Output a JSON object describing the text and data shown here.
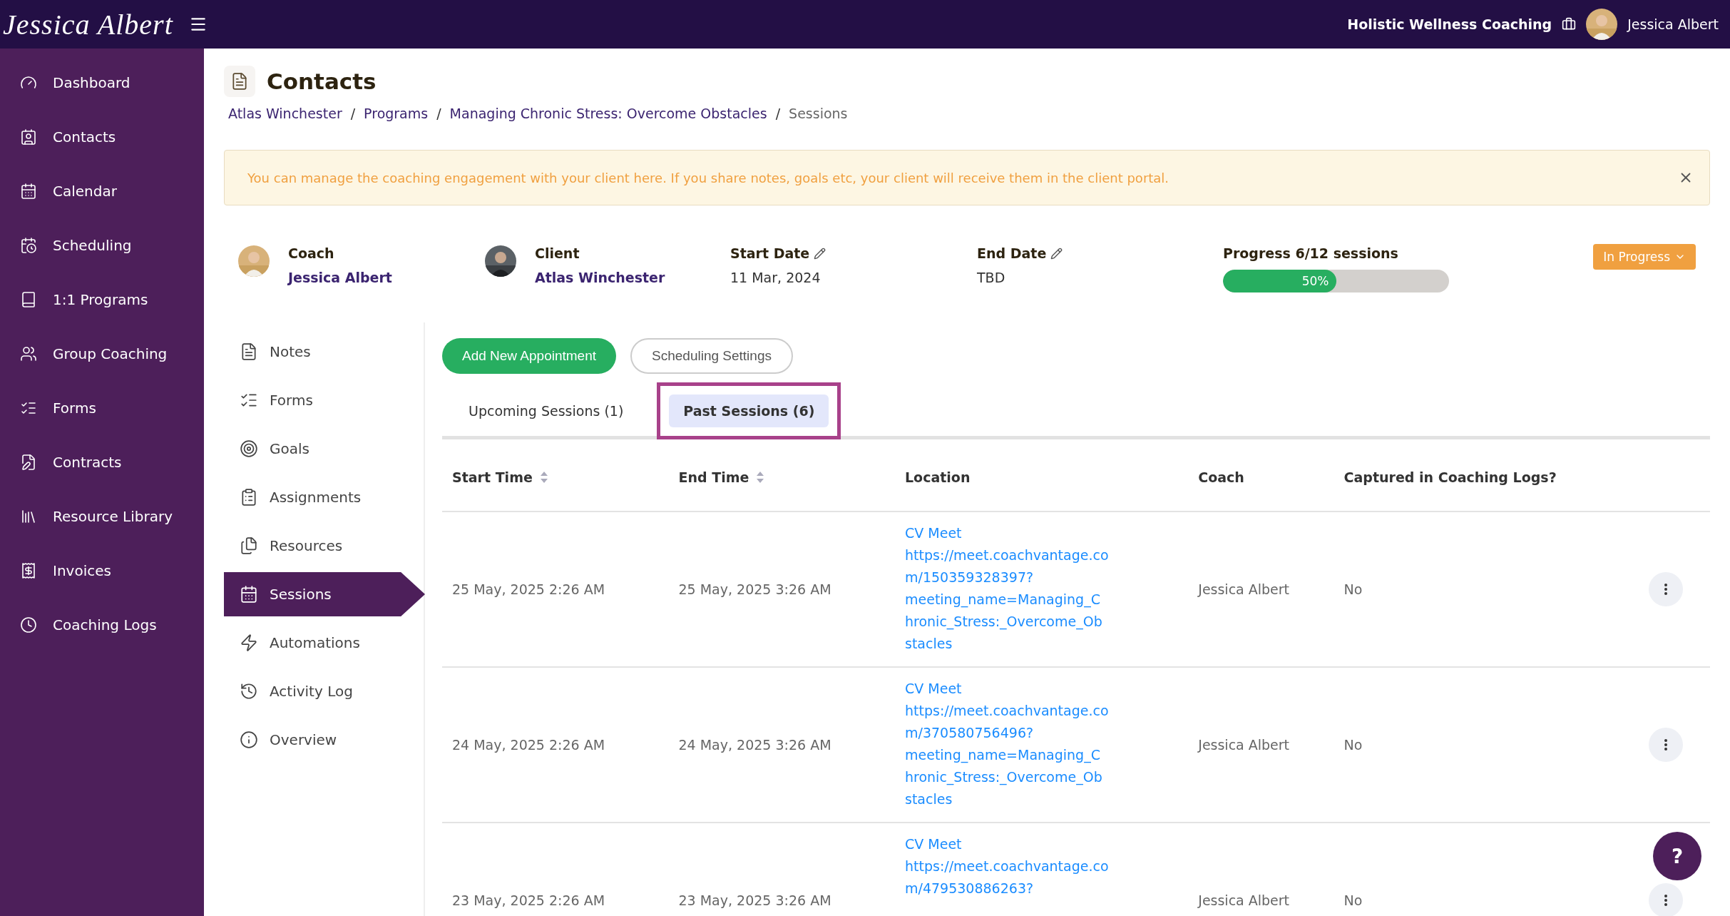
{
  "header": {
    "logo": "Jessica Albert",
    "business": "Holistic Wellness Coaching",
    "user": "Jessica Albert"
  },
  "sidebar": {
    "items": [
      {
        "label": "Dashboard",
        "selected": false
      },
      {
        "label": "Contacts",
        "selected": false
      },
      {
        "label": "Calendar",
        "selected": false
      },
      {
        "label": "Scheduling",
        "selected": false
      },
      {
        "label": "1:1 Programs",
        "selected": false
      },
      {
        "label": "Group Coaching",
        "selected": false
      },
      {
        "label": "Forms",
        "selected": false
      },
      {
        "label": "Contracts",
        "selected": false
      },
      {
        "label": "Resource Library",
        "selected": false
      },
      {
        "label": "Invoices",
        "selected": false
      },
      {
        "label": "Coaching Logs",
        "selected": false
      }
    ]
  },
  "page": {
    "title": "Contacts",
    "breadcrumb": {
      "separator": "/",
      "items": [
        {
          "label": "Atlas Winchester",
          "current": false
        },
        {
          "label": "Programs",
          "current": false
        },
        {
          "label": "Managing Chronic Stress: Overcome Obstacles",
          "current": false
        },
        {
          "label": "Sessions",
          "current": true
        }
      ]
    },
    "alert": {
      "text": "You can manage the coaching engagement with your client here. If you share notes, goals etc, your client will receive them in the client portal.",
      "dismissible": true
    },
    "coach": {
      "label": "Coach",
      "name": "Jessica Albert"
    },
    "client": {
      "label": "Client",
      "name": "Atlas Winchester"
    },
    "start_date": {
      "label": "Start Date",
      "value": "11 Mar, 2024",
      "editable": true
    },
    "end_date": {
      "label": "End Date",
      "value": "TBD",
      "editable": true
    },
    "progress": {
      "label": "Progress 6/12 sessions",
      "level": 0.5,
      "reading": "50%"
    },
    "status": {
      "label": "In Progress"
    }
  },
  "program_nav": {
    "items": [
      {
        "label": "Notes",
        "selected": false
      },
      {
        "label": "Forms",
        "selected": false
      },
      {
        "label": "Goals",
        "selected": false
      },
      {
        "label": "Assignments",
        "selected": false
      },
      {
        "label": "Resources",
        "selected": false
      },
      {
        "label": "Sessions",
        "selected": true
      },
      {
        "label": "Automations",
        "selected": false
      },
      {
        "label": "Activity Log",
        "selected": false
      },
      {
        "label": "Overview",
        "selected": false
      }
    ]
  },
  "actions": [
    {
      "label": "Add New Appointment",
      "kind": "primary"
    },
    {
      "label": "Scheduling Settings",
      "kind": "outline"
    }
  ],
  "tabs": [
    {
      "label": "Upcoming Sessions (1)",
      "selected": false,
      "highlighted": false
    },
    {
      "label": "Past Sessions (6)",
      "selected": true,
      "highlighted": true
    }
  ],
  "table": {
    "columns": [
      {
        "label": "Start Time",
        "sortable": true
      },
      {
        "label": "End Time",
        "sortable": true
      },
      {
        "label": "Location",
        "sortable": false
      },
      {
        "label": "Coach",
        "sortable": false
      },
      {
        "label": "Captured in Coaching Logs?",
        "sortable": false
      }
    ],
    "rows": [
      {
        "start": "25 May, 2025 2:26 AM",
        "end": "25 May, 2025 3:26 AM",
        "location_lines": [
          "CV Meet",
          "https://meet.coachvantage.co",
          "m/150359328397?",
          "meeting_name=Managing_C",
          "hronic_Stress:_Overcome_Ob",
          "stacles"
        ],
        "coach": "Jessica Albert",
        "captured": "No"
      },
      {
        "start": "24 May, 2025 2:26 AM",
        "end": "24 May, 2025 3:26 AM",
        "location_lines": [
          "CV Meet",
          "https://meet.coachvantage.co",
          "m/370580756496?",
          "meeting_name=Managing_C",
          "hronic_Stress:_Overcome_Ob",
          "stacles"
        ],
        "coach": "Jessica Albert",
        "captured": "No"
      },
      {
        "start": "23 May, 2025 2:26 AM",
        "end": "23 May, 2025 3:26 AM",
        "location_lines": [
          "CV Meet",
          "https://meet.coachvantage.co",
          "m/479530886263?"
        ],
        "coach": "Jessica Albert",
        "captured": "No"
      }
    ]
  },
  "help": {
    "label": "?"
  }
}
